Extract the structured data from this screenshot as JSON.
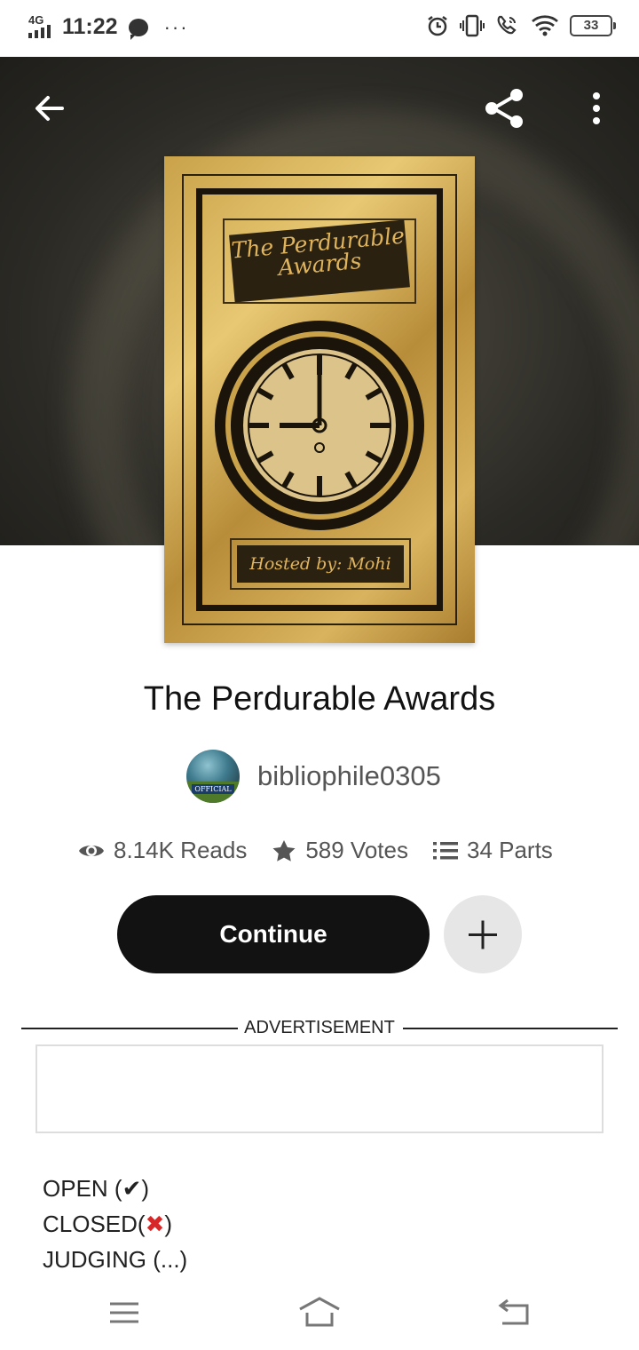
{
  "status_bar": {
    "network": "4G",
    "time": "11:22",
    "more": "···",
    "battery": "33"
  },
  "story": {
    "title": "The Perdurable Awards",
    "cover_title": "The Perdurable Awards",
    "cover_hosted": "Hosted by: Mohi",
    "author": "bibliophile0305",
    "avatar_badge": "OFFICIAL",
    "reads": "8.14K Reads",
    "votes": "589 Votes",
    "parts": "34 Parts"
  },
  "actions": {
    "continue_label": "Continue"
  },
  "ad": {
    "label": "ADVERTISEMENT"
  },
  "description": {
    "line1_text": "OPEN (",
    "line1_mark": "✔",
    "line1_end": ")",
    "line2_text": "CLOSED(",
    "line2_mark": "✖",
    "line2_end": ")",
    "line3": "JUDGING (...)"
  },
  "icons": {
    "back": "arrow-left-icon",
    "share": "share-icon",
    "more": "more-vert-icon",
    "reads": "eye-icon",
    "votes": "star-icon",
    "parts": "list-icon",
    "add": "plus-icon"
  }
}
